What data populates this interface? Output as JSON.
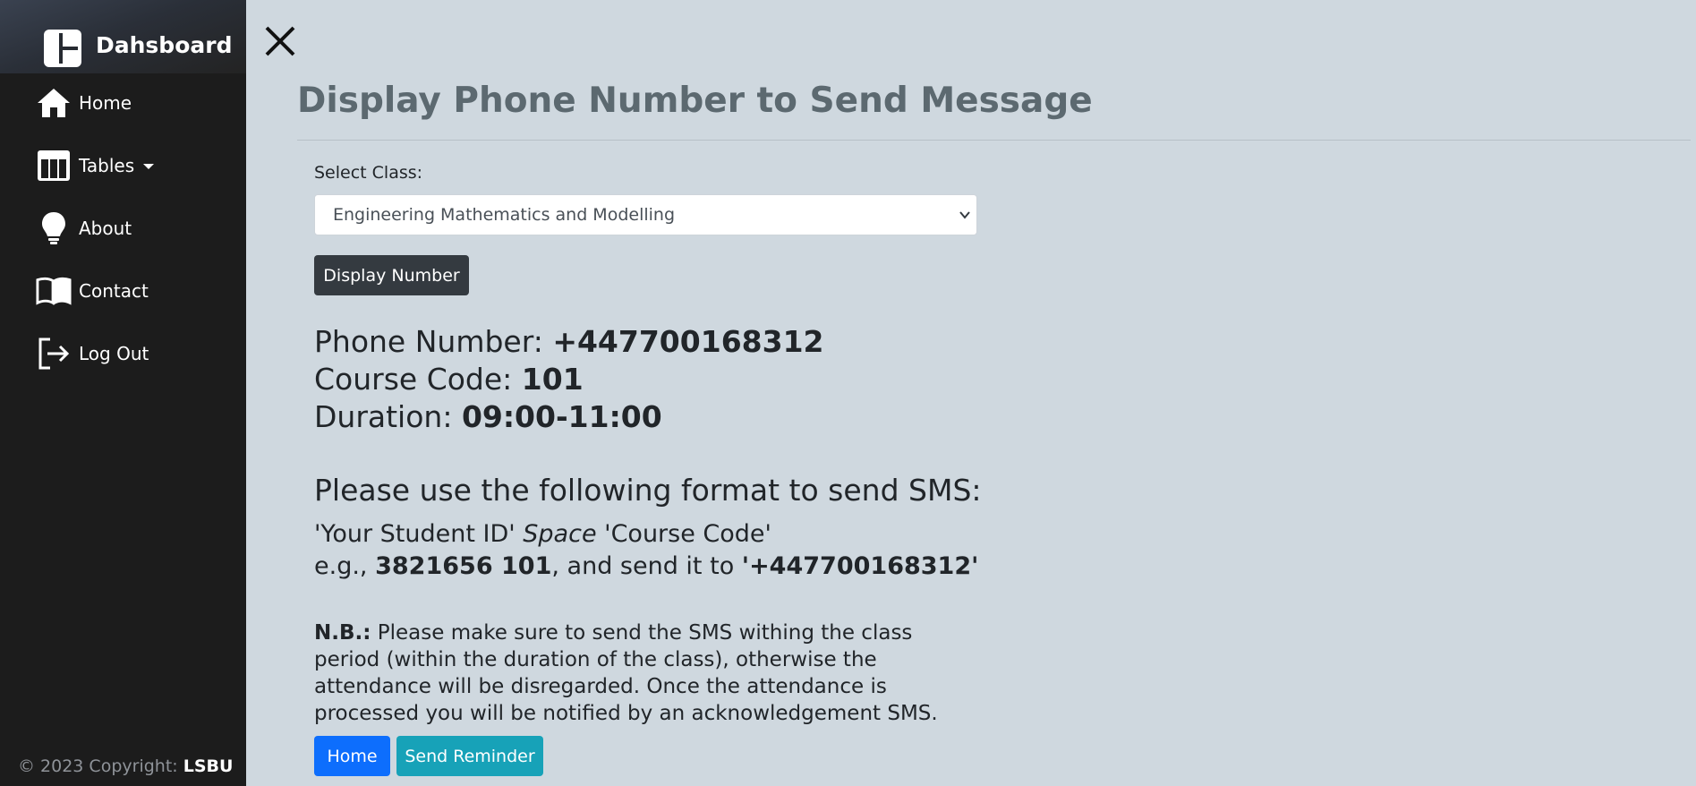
{
  "sidebar": {
    "brand": "Dahsboard",
    "items": [
      {
        "label": "Home",
        "icon": "home-icon"
      },
      {
        "label": "Tables",
        "icon": "table-icon"
      },
      {
        "label": "About",
        "icon": "lightbulb-icon"
      },
      {
        "label": "Contact",
        "icon": "book-icon"
      },
      {
        "label": "Log Out",
        "icon": "logout-icon"
      }
    ],
    "footer_prefix": "© 2023 Copyright: ",
    "footer_brand": "LSBU"
  },
  "main": {
    "title": "Display Phone Number to Send Message",
    "select_label": "Select Class:",
    "selected_class": "Engineering Mathematics and Modelling",
    "display_button": "Display Number",
    "phone_label": "Phone Number: ",
    "phone_value": "+447700168312",
    "course_label": "Course Code: ",
    "course_value": "101",
    "duration_label": "Duration: ",
    "duration_value": "09:00-11:00",
    "format_heading": "Please use the following format to send SMS:",
    "format_part1": "'Your Student ID' ",
    "format_space": "Space",
    "format_part2": " 'Course Code'",
    "example_prefix": "e.g., ",
    "example_value": "3821656 101",
    "example_middle": ", and send it to ",
    "example_number": "'+447700168312'",
    "note_label": "N.B.:",
    "note_text": " Please make sure to send the SMS withing the class period (within the duration of the class), otherwise the attendance will be disregarded. Once the attendance is processed you will be notified by an acknowledgement SMS.",
    "home_button": "Home",
    "reminder_button": "Send Reminder"
  },
  "colors": {
    "sidebar_bg": "#1c1c1c",
    "main_bg": "#cfd8df",
    "title": "#5c6970",
    "primary": "#0d6efd",
    "info": "#17a2b8",
    "dark_button": "#343a40"
  }
}
